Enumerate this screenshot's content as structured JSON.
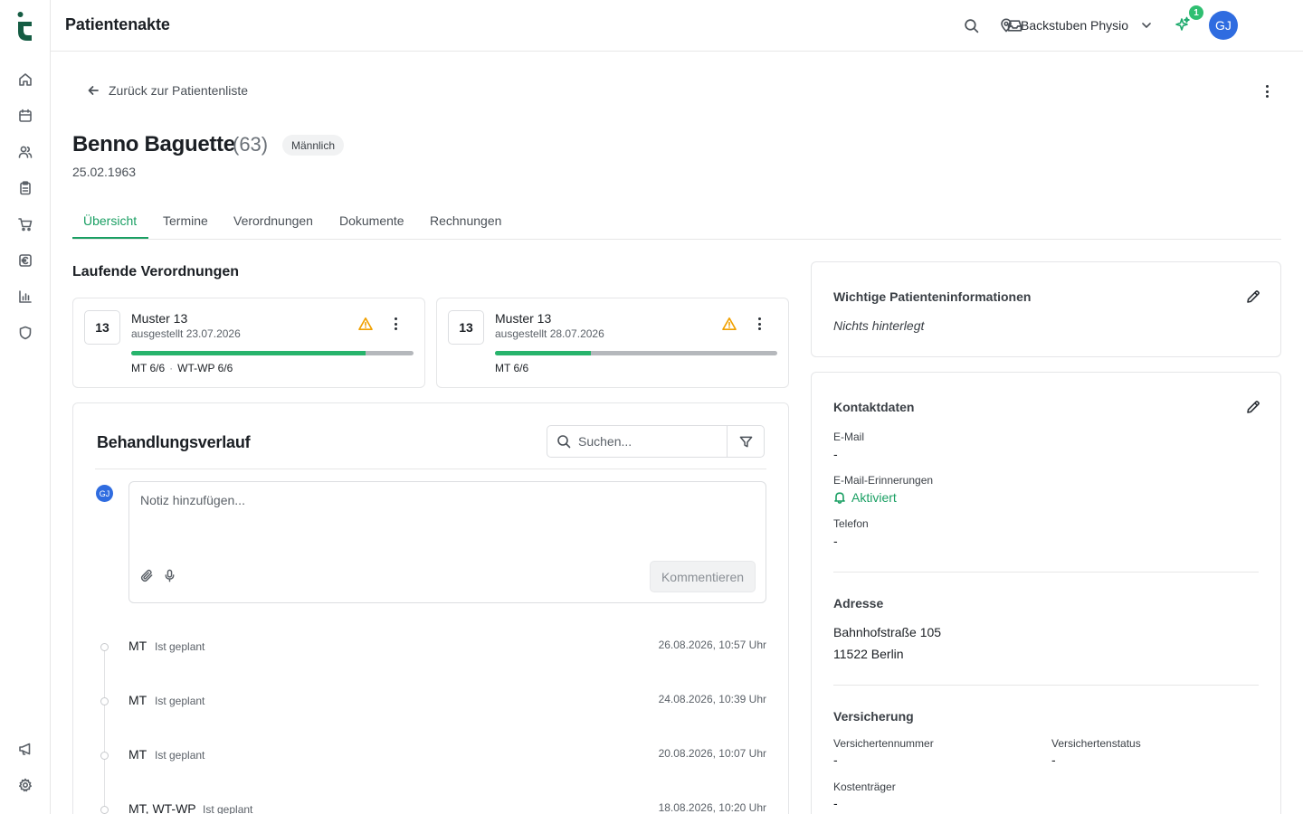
{
  "app": {
    "title": "Patientenakte",
    "location": "Backstuben Physio",
    "notification_count": "1",
    "user_initials": "GJ"
  },
  "colors": {
    "brand": "#1a9f63",
    "logo": "#155c43",
    "progress": "#27b46c",
    "warning": "#f0a000",
    "avatar": "#2f6ce0"
  },
  "sidebar": {
    "items": [
      {
        "icon": "home-icon"
      },
      {
        "icon": "calendar-icon"
      },
      {
        "icon": "users-icon"
      },
      {
        "icon": "clipboard-icon"
      },
      {
        "icon": "cart-icon"
      },
      {
        "icon": "euro-icon"
      },
      {
        "icon": "bar-chart-icon"
      },
      {
        "icon": "shield-icon"
      }
    ],
    "bottom": [
      {
        "icon": "megaphone-icon"
      },
      {
        "icon": "settings-icon"
      }
    ]
  },
  "page": {
    "back_label": "Zurück zur Patientenliste"
  },
  "patient": {
    "name": "Benno Baguette",
    "age": "(63)",
    "gender": "Männlich",
    "dob": "25.02.1963"
  },
  "tabs": [
    {
      "label": "Übersicht",
      "active": true
    },
    {
      "label": "Termine"
    },
    {
      "label": "Verordnungen"
    },
    {
      "label": "Dokumente"
    },
    {
      "label": "Rechnungen"
    }
  ],
  "prescriptions": {
    "title": "Laufende Verordnungen",
    "items": [
      {
        "number": "13",
        "title": "Muster 13",
        "issued": "ausgestellt 23.07.2026",
        "progress": 0.83,
        "services": [
          "MT 6/6",
          "WT-WP 6/6"
        ]
      },
      {
        "number": "13",
        "title": "Muster 13",
        "issued": "ausgestellt 28.07.2026",
        "progress": 0.34,
        "services": [
          "MT 6/6"
        ]
      }
    ]
  },
  "history": {
    "title": "Behandlungsverlauf",
    "search_placeholder": "Suchen...",
    "note_placeholder": "Notiz hinzufügen...",
    "note_avatar": "GJ",
    "comment_label": "Kommentieren",
    "entries": [
      {
        "type": "MT",
        "status": "Ist geplant",
        "date": "26.08.2026, 10:57 Uhr"
      },
      {
        "type": "MT",
        "status": "Ist geplant",
        "date": "24.08.2026, 10:39 Uhr"
      },
      {
        "type": "MT",
        "status": "Ist geplant",
        "date": "20.08.2026, 10:07 Uhr"
      },
      {
        "type": "MT, WT-WP",
        "status": "Ist geplant",
        "date": "18.08.2026, 10:20 Uhr"
      }
    ]
  },
  "important_info": {
    "title": "Wichtige Patienteninformationen",
    "value": "Nichts hinterlegt"
  },
  "contact": {
    "title": "Kontaktdaten",
    "email_label": "E-Mail",
    "email_value": "-",
    "reminder_label": "E-Mail-Erinnerungen",
    "reminder_value": "Aktiviert",
    "phone_label": "Telefon",
    "phone_value": "-",
    "address_title": "Adresse",
    "address_line1": "Bahnhofstraße 105",
    "address_line2": "11522 Berlin",
    "insurance_title": "Versicherung",
    "insurance_number_label": "Versichertennummer",
    "insurance_number_value": "-",
    "insurance_status_label": "Versichertenstatus",
    "insurance_status_value": "-",
    "payer_label": "Kostenträger",
    "payer_value": "-"
  }
}
